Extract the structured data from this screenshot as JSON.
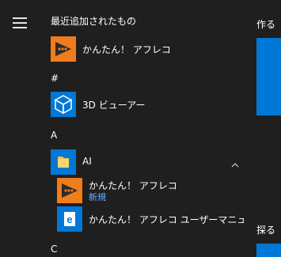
{
  "sections": {
    "recent": "最近追加されたもの",
    "hash": "#",
    "a": "A",
    "c": "C"
  },
  "apps": {
    "kantan1": "かんたん！ アフレコ",
    "viewer3d": "3D ビューアー",
    "ai_folder": "AI",
    "kantan2": "かんたん！ アフレコ",
    "kantan2_badge": "新規",
    "manual": "かんたん！ アフレコ ユーザーマニュアル"
  },
  "right_groups": {
    "make": "作る",
    "explore": "探る"
  },
  "icons": {
    "menu": "hamburger-icon",
    "kantan": "afureco-logo-icon",
    "viewer": "cube-icon",
    "folder": "folder-icon",
    "manual": "document-e-icon",
    "chevron": "chevron-up-icon"
  },
  "colors": {
    "background": "#1f1f1f",
    "accent_blue": "#0078d7",
    "orange_logo": "#f07c1c",
    "new_badge": "#5fb2ff",
    "folder_yellow": "#f4c242"
  }
}
